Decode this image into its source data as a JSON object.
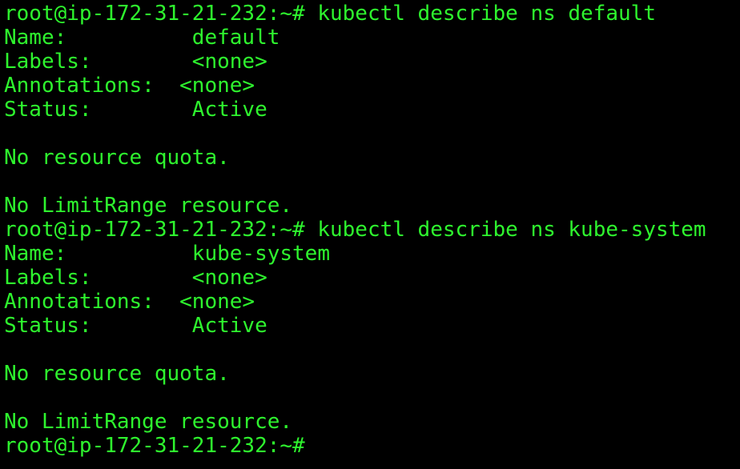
{
  "terminal": {
    "text_color": "#2ef52e",
    "background_color": "#000000",
    "lines": [
      "root@ip-172-31-21-232:~# kubectl describe ns default",
      "Name:          default",
      "Labels:        <none>",
      "Annotations:  <none>",
      "Status:        Active",
      "",
      "No resource quota.",
      "",
      "No LimitRange resource.",
      "root@ip-172-31-21-232:~# kubectl describe ns kube-system",
      "Name:          kube-system",
      "Labels:        <none>",
      "Annotations:  <none>",
      "Status:        Active",
      "",
      "No resource quota.",
      "",
      "No LimitRange resource.",
      "root@ip-172-31-21-232:~#"
    ]
  }
}
